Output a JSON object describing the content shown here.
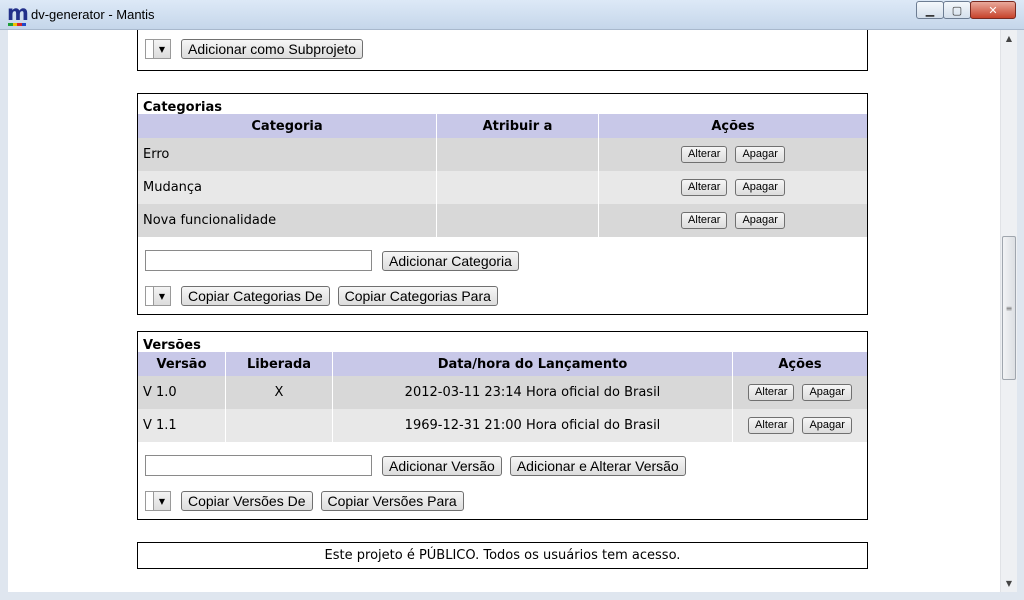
{
  "window": {
    "title": "dv-generator - Mantis",
    "logo_letter": "m",
    "logo_colors": [
      "#1d9d3a",
      "#f0c000",
      "#d8262a",
      "#2148c8"
    ],
    "minimize_icon": "minimize-icon",
    "maximize_icon": "maximize-icon",
    "close_icon": "close-icon"
  },
  "subproject": {
    "add_button": "Adicionar como Subprojeto"
  },
  "categories": {
    "title": "Categorias",
    "headers": [
      "Categoria",
      "Atribuir a",
      "Ações"
    ],
    "rows": [
      {
        "name": "Erro",
        "assigned": "",
        "edit": "Alterar",
        "delete": "Apagar"
      },
      {
        "name": "Mudança",
        "assigned": "",
        "edit": "Alterar",
        "delete": "Apagar"
      },
      {
        "name": "Nova funcionalidade",
        "assigned": "",
        "edit": "Alterar",
        "delete": "Apagar"
      }
    ],
    "new_category_value": "",
    "add_button": "Adicionar Categoria",
    "copy_from_button": "Copiar Categorias De",
    "copy_to_button": "Copiar Categorias Para"
  },
  "versions": {
    "title": "Versões",
    "headers": [
      "Versão",
      "Liberada",
      "Data/hora do Lançamento",
      "Ações"
    ],
    "rows": [
      {
        "version": "V 1.0",
        "released": "X",
        "date": "2012-03-11 23:14 Hora oficial do Brasil",
        "edit": "Alterar",
        "delete": "Apagar"
      },
      {
        "version": "V 1.1",
        "released": "",
        "date": "1969-12-31 21:00 Hora oficial do Brasil",
        "edit": "Alterar",
        "delete": "Apagar"
      }
    ],
    "new_version_value": "",
    "add_button": "Adicionar Versão",
    "add_edit_button": "Adicionar e Alterar Versão",
    "copy_from_button": "Copiar Versões De",
    "copy_to_button": "Copiar Versões Para"
  },
  "notice": "Este projeto é PÚBLICO. Todos os usuários tem acesso."
}
